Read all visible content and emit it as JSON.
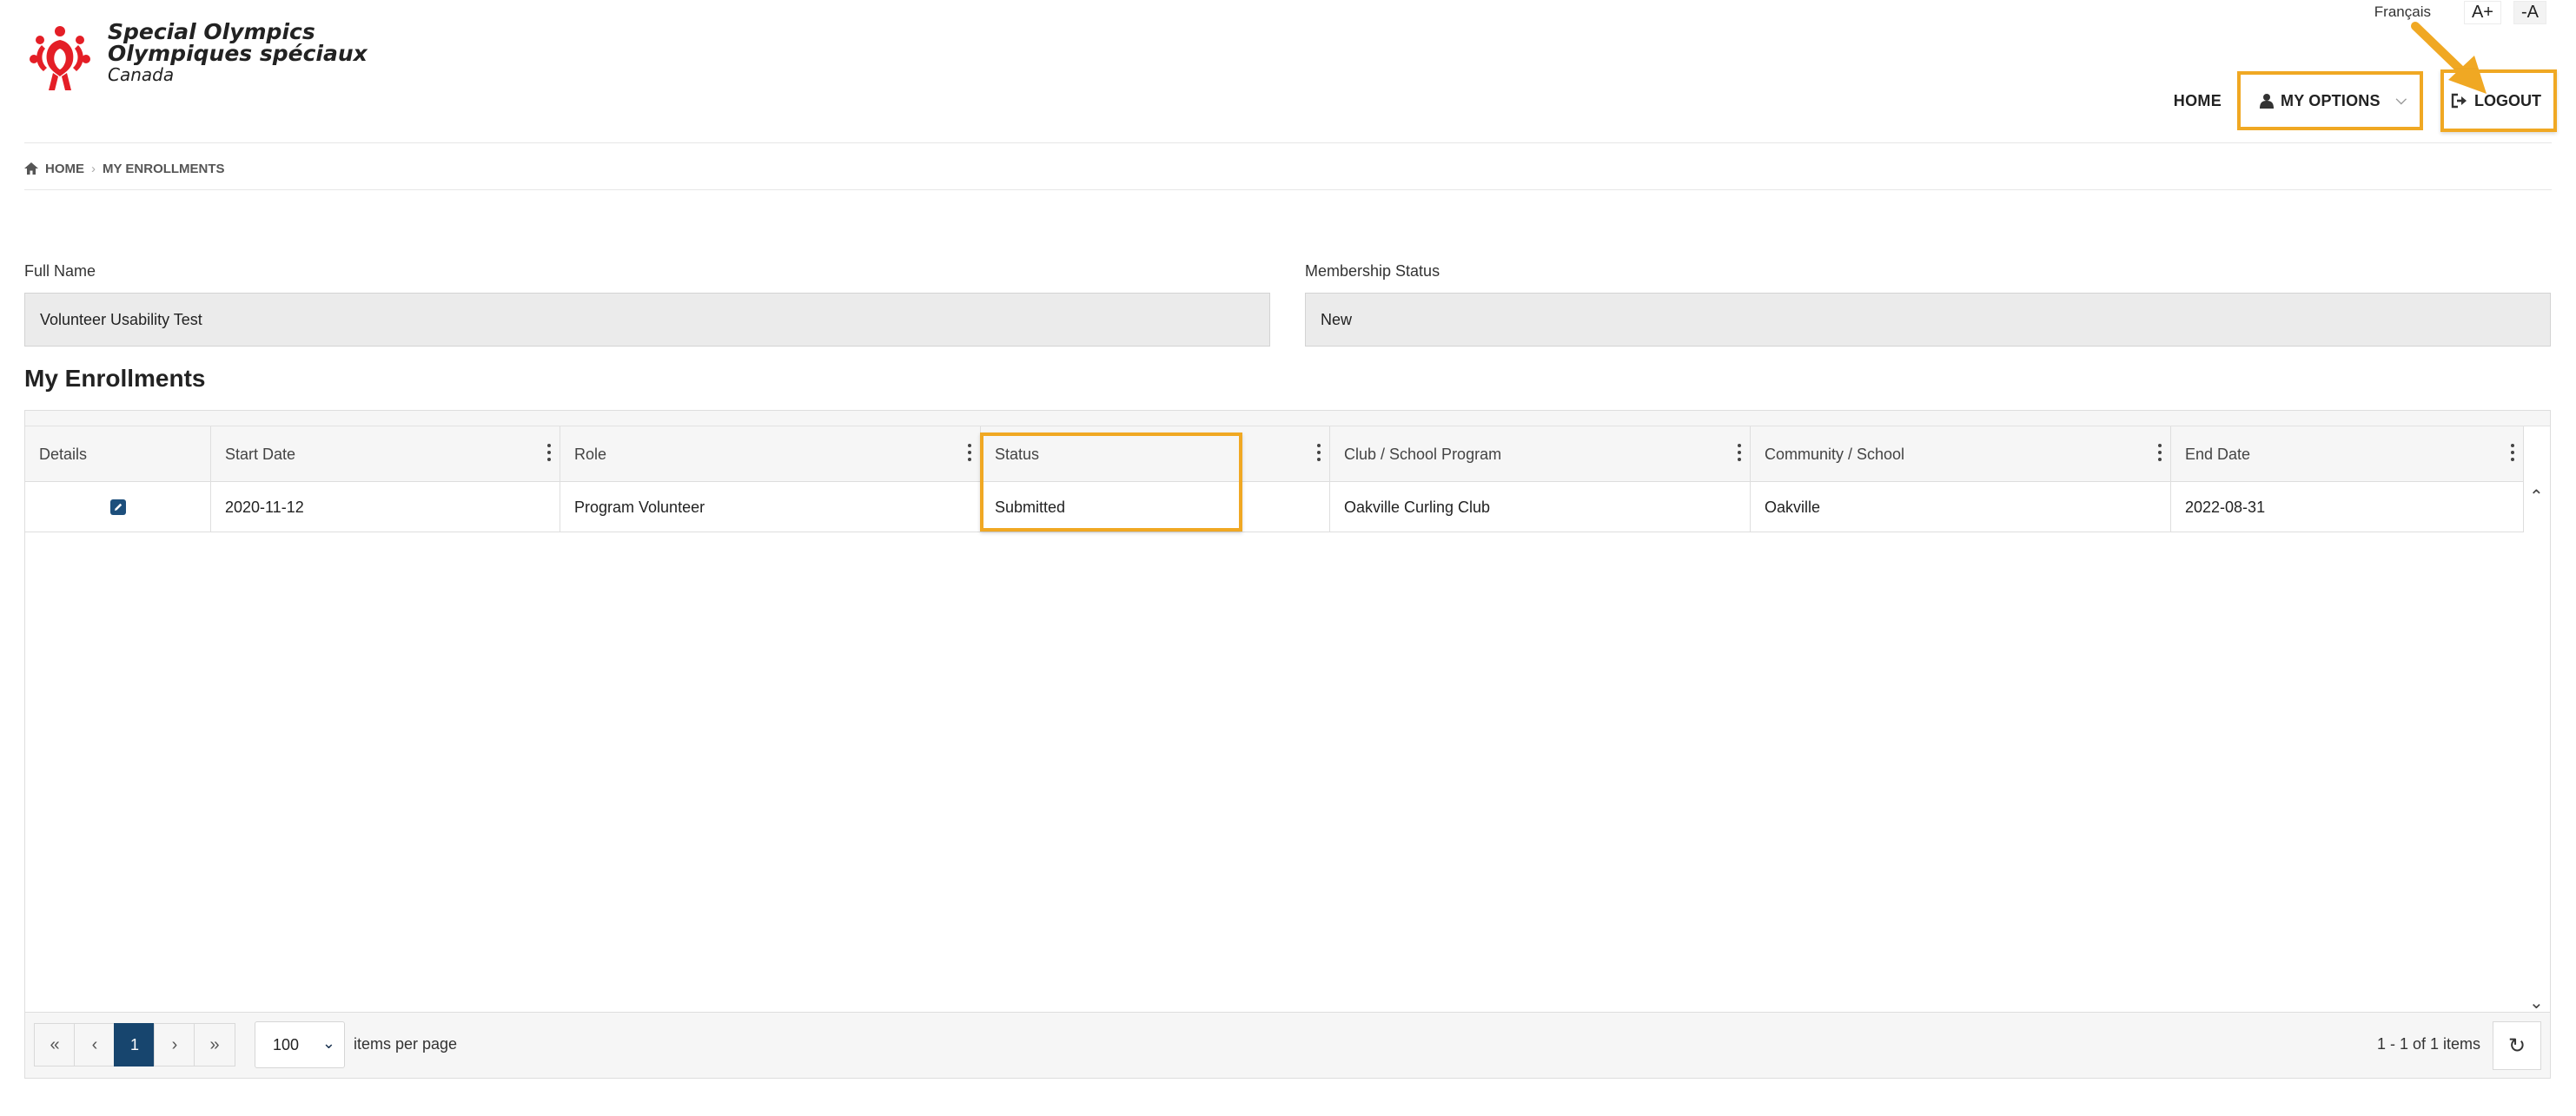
{
  "brand": {
    "line1": "Special Olympics",
    "line2": "Olympiques spéciaux",
    "line3": "Canada",
    "color": "#e41e26"
  },
  "topbar": {
    "language": "Français",
    "font_increase": "A+",
    "font_decrease": "-A"
  },
  "nav": {
    "home": "HOME",
    "my_options": "MY OPTIONS",
    "logout": "LOGOUT",
    "my_options_icon": "user-icon",
    "logout_icon": "sign-out-icon"
  },
  "breadcrumb": {
    "home": "HOME",
    "current": "MY ENROLLMENTS"
  },
  "form": {
    "full_name_label": "Full Name",
    "full_name_value": "Volunteer Usability Test",
    "membership_label": "Membership Status",
    "membership_value": "New"
  },
  "section_title": "My Enrollments",
  "table": {
    "columns": [
      "Details",
      "Start Date",
      "Role",
      "Status",
      "Club / School Program",
      "Community / School",
      "End Date"
    ],
    "rows": [
      {
        "details_icon": "edit-icon",
        "start_date": "2020-11-12",
        "role": "Program Volunteer",
        "status": "Submitted",
        "club": "Oakville Curling Club",
        "community": "Oakville",
        "end_date": "2022-08-31"
      }
    ]
  },
  "pager": {
    "current_page": "1",
    "page_size": "100",
    "items_per_page_label": "items per page",
    "range_text": "1 - 1 of 1 items"
  },
  "colors": {
    "highlight": "#f0a823",
    "pager_active": "#17456e",
    "edit_icon": "#1d4f7c"
  }
}
